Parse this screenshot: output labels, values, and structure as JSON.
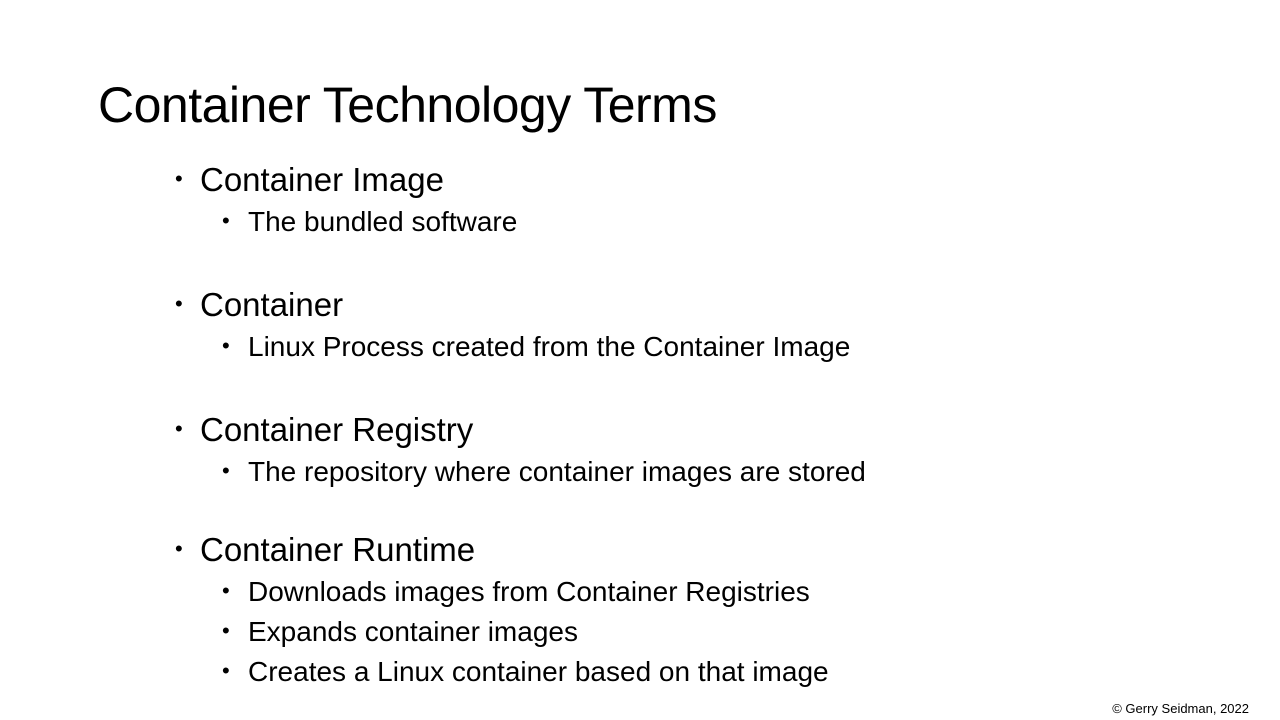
{
  "slide": {
    "title": "Container Technology Terms",
    "bullet_glyph": "•",
    "items": [
      {
        "term": "Container Image",
        "details": [
          "The bundled software"
        ]
      },
      {
        "term": "Container",
        "details": [
          "Linux Process created from the Container Image"
        ]
      },
      {
        "term": "Container Registry",
        "details": [
          "The repository where container images are stored"
        ]
      },
      {
        "term": "Container Runtime",
        "details": [
          "Downloads images from Container Registries",
          "Expands container images",
          "Creates a Linux container based on that image"
        ]
      }
    ],
    "footer": "© Gerry Seidman, 2022"
  }
}
